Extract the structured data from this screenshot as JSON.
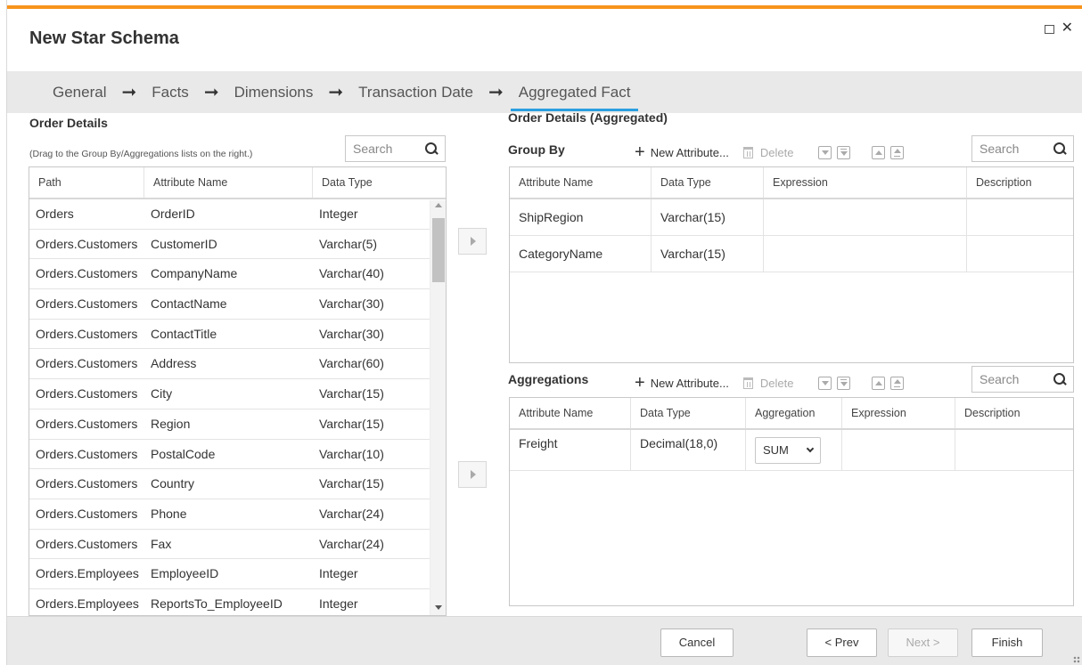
{
  "dialog": {
    "title": "New Star Schema"
  },
  "wizard": {
    "steps": [
      "General",
      "Facts",
      "Dimensions",
      "Transaction Date",
      "Aggregated Fact"
    ],
    "active_step": "Aggregated Fact",
    "arrow": "➞"
  },
  "left": {
    "title": "Order Details",
    "hint": "(Drag to the Group By/Aggregations lists on the right.)",
    "search_placeholder": "Search",
    "columns": [
      "Path",
      "Attribute Name",
      "Data Type"
    ],
    "rows": [
      [
        "Orders",
        "OrderID",
        "Integer"
      ],
      [
        "Orders.Customers",
        "CustomerID",
        "Varchar(5)"
      ],
      [
        "Orders.Customers",
        "CompanyName",
        "Varchar(40)"
      ],
      [
        "Orders.Customers",
        "ContactName",
        "Varchar(30)"
      ],
      [
        "Orders.Customers",
        "ContactTitle",
        "Varchar(30)"
      ],
      [
        "Orders.Customers",
        "Address",
        "Varchar(60)"
      ],
      [
        "Orders.Customers",
        "City",
        "Varchar(15)"
      ],
      [
        "Orders.Customers",
        "Region",
        "Varchar(15)"
      ],
      [
        "Orders.Customers",
        "PostalCode",
        "Varchar(10)"
      ],
      [
        "Orders.Customers",
        "Country",
        "Varchar(15)"
      ],
      [
        "Orders.Customers",
        "Phone",
        "Varchar(24)"
      ],
      [
        "Orders.Customers",
        "Fax",
        "Varchar(24)"
      ],
      [
        "Orders.Employees",
        "EmployeeID",
        "Integer"
      ],
      [
        "Orders.Employees",
        "ReportsTo_EmployeeID",
        "Integer"
      ]
    ]
  },
  "right": {
    "title": "Order Details (Aggregated)",
    "group_by": {
      "title": "Group By",
      "new_attribute": "New Attribute...",
      "delete": "Delete",
      "search_placeholder": "Search",
      "columns": [
        "Attribute Name",
        "Data Type",
        "Expression",
        "Description"
      ],
      "rows": [
        [
          "ShipRegion",
          "Varchar(15)",
          "",
          ""
        ],
        [
          "CategoryName",
          "Varchar(15)",
          "",
          ""
        ]
      ]
    },
    "aggregations": {
      "title": "Aggregations",
      "new_attribute": "New Attribute...",
      "delete": "Delete",
      "search_placeholder": "Search",
      "columns": [
        "Attribute Name",
        "Data Type",
        "Aggregation",
        "Expression",
        "Description"
      ],
      "rows": [
        {
          "name": "Freight",
          "type": "Decimal(18,0)",
          "aggregation": "SUM",
          "expression": "",
          "description": ""
        }
      ]
    }
  },
  "footer": {
    "cancel": "Cancel",
    "prev": "< Prev",
    "next": "Next >",
    "finish": "Finish"
  },
  "colors": {
    "accent_top": "#f7941d",
    "active_tab": "#2b9fe0"
  }
}
